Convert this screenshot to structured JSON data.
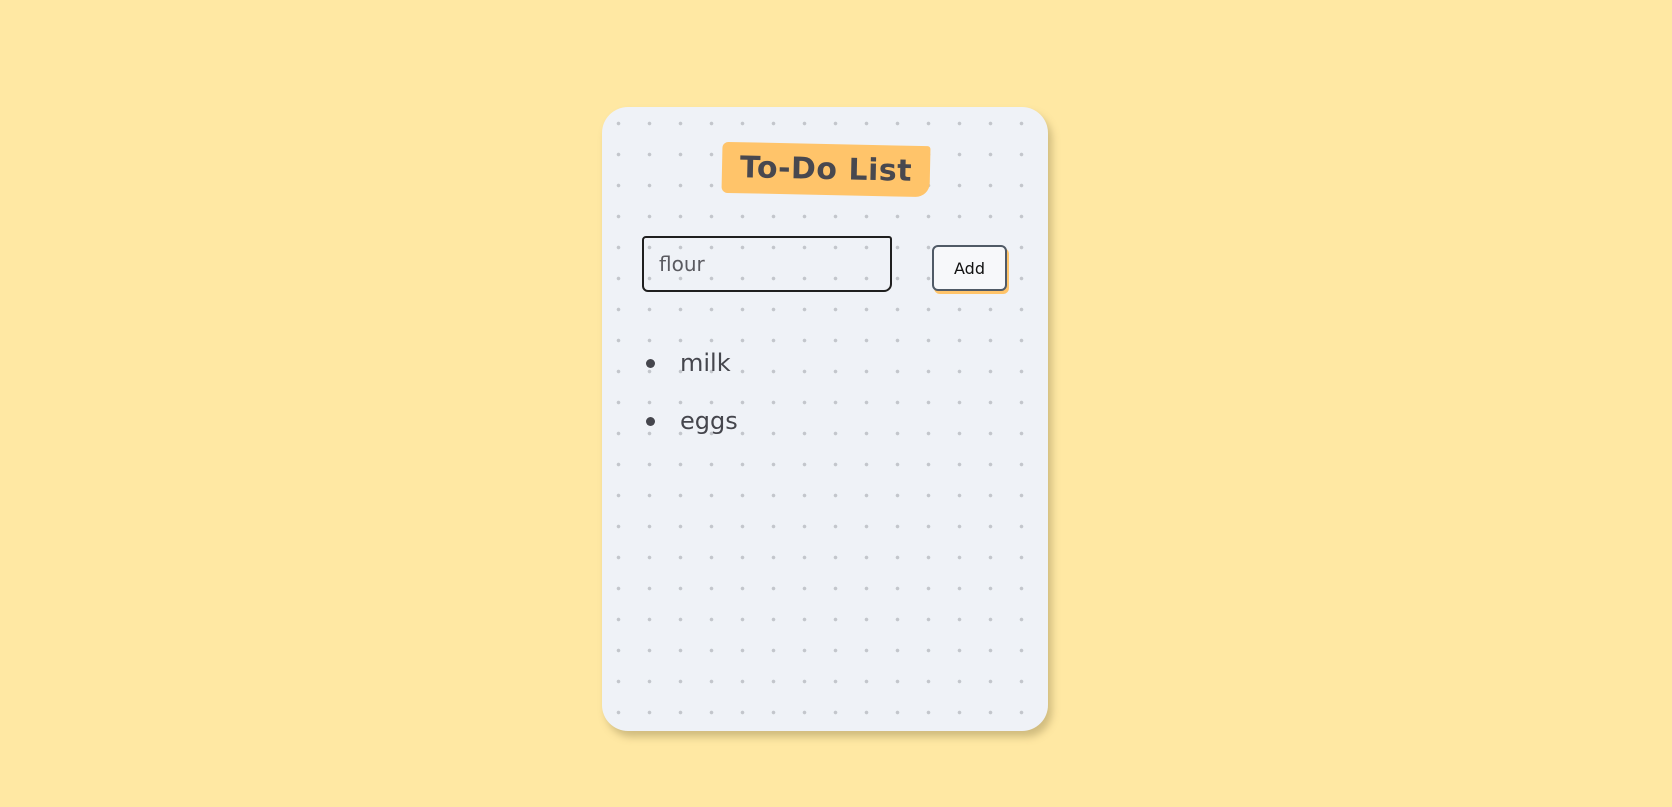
{
  "app": {
    "title": "To-Do List"
  },
  "input": {
    "value": "flour",
    "placeholder": ""
  },
  "add_button": {
    "label": "Add"
  },
  "todos": [
    {
      "text": "milk"
    },
    {
      "text": "eggs"
    }
  ],
  "colors": {
    "page_background": "#ffe8a3",
    "card_background": "#eff2f7",
    "title_highlight": "#ffc46a",
    "text": "#45464d",
    "dot_grid": "#c3c6cc"
  }
}
